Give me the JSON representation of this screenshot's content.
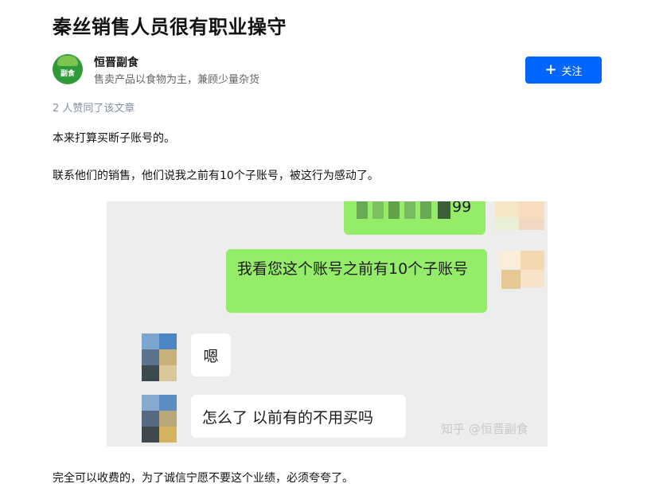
{
  "article": {
    "title": "秦丝销售人员很有职业操守",
    "likes_text": "2 人赞同了该文章",
    "paragraphs": [
      "本来打算买断子账号的。",
      "联系他们的销售，他们说我之前有10个子账号，被这行为感动了。",
      "完全可以收费的，为了诚信宁愿不要这个业绩，必须夸夸了。"
    ]
  },
  "author": {
    "name": "恒晋副食",
    "bio": "售卖产品以食物为主，兼顾少量杂货",
    "avatar_icon": "green-leaf-logo",
    "avatar_text": "副食"
  },
  "follow_button": {
    "icon": "plus-icon",
    "label": "关注",
    "color": "#0066ff"
  },
  "chat_image": {
    "top_bubble_partial": "99",
    "messages": [
      {
        "side": "right",
        "text": "我看您这个账号之前有10个子账号"
      },
      {
        "side": "left",
        "text": "嗯"
      },
      {
        "side": "left",
        "text": "怎么了 以前有的不用买吗"
      }
    ],
    "watermark": "知乎 @恒晋副食",
    "colors": {
      "green_bubble": "#95ec69",
      "background": "#ededed"
    }
  }
}
